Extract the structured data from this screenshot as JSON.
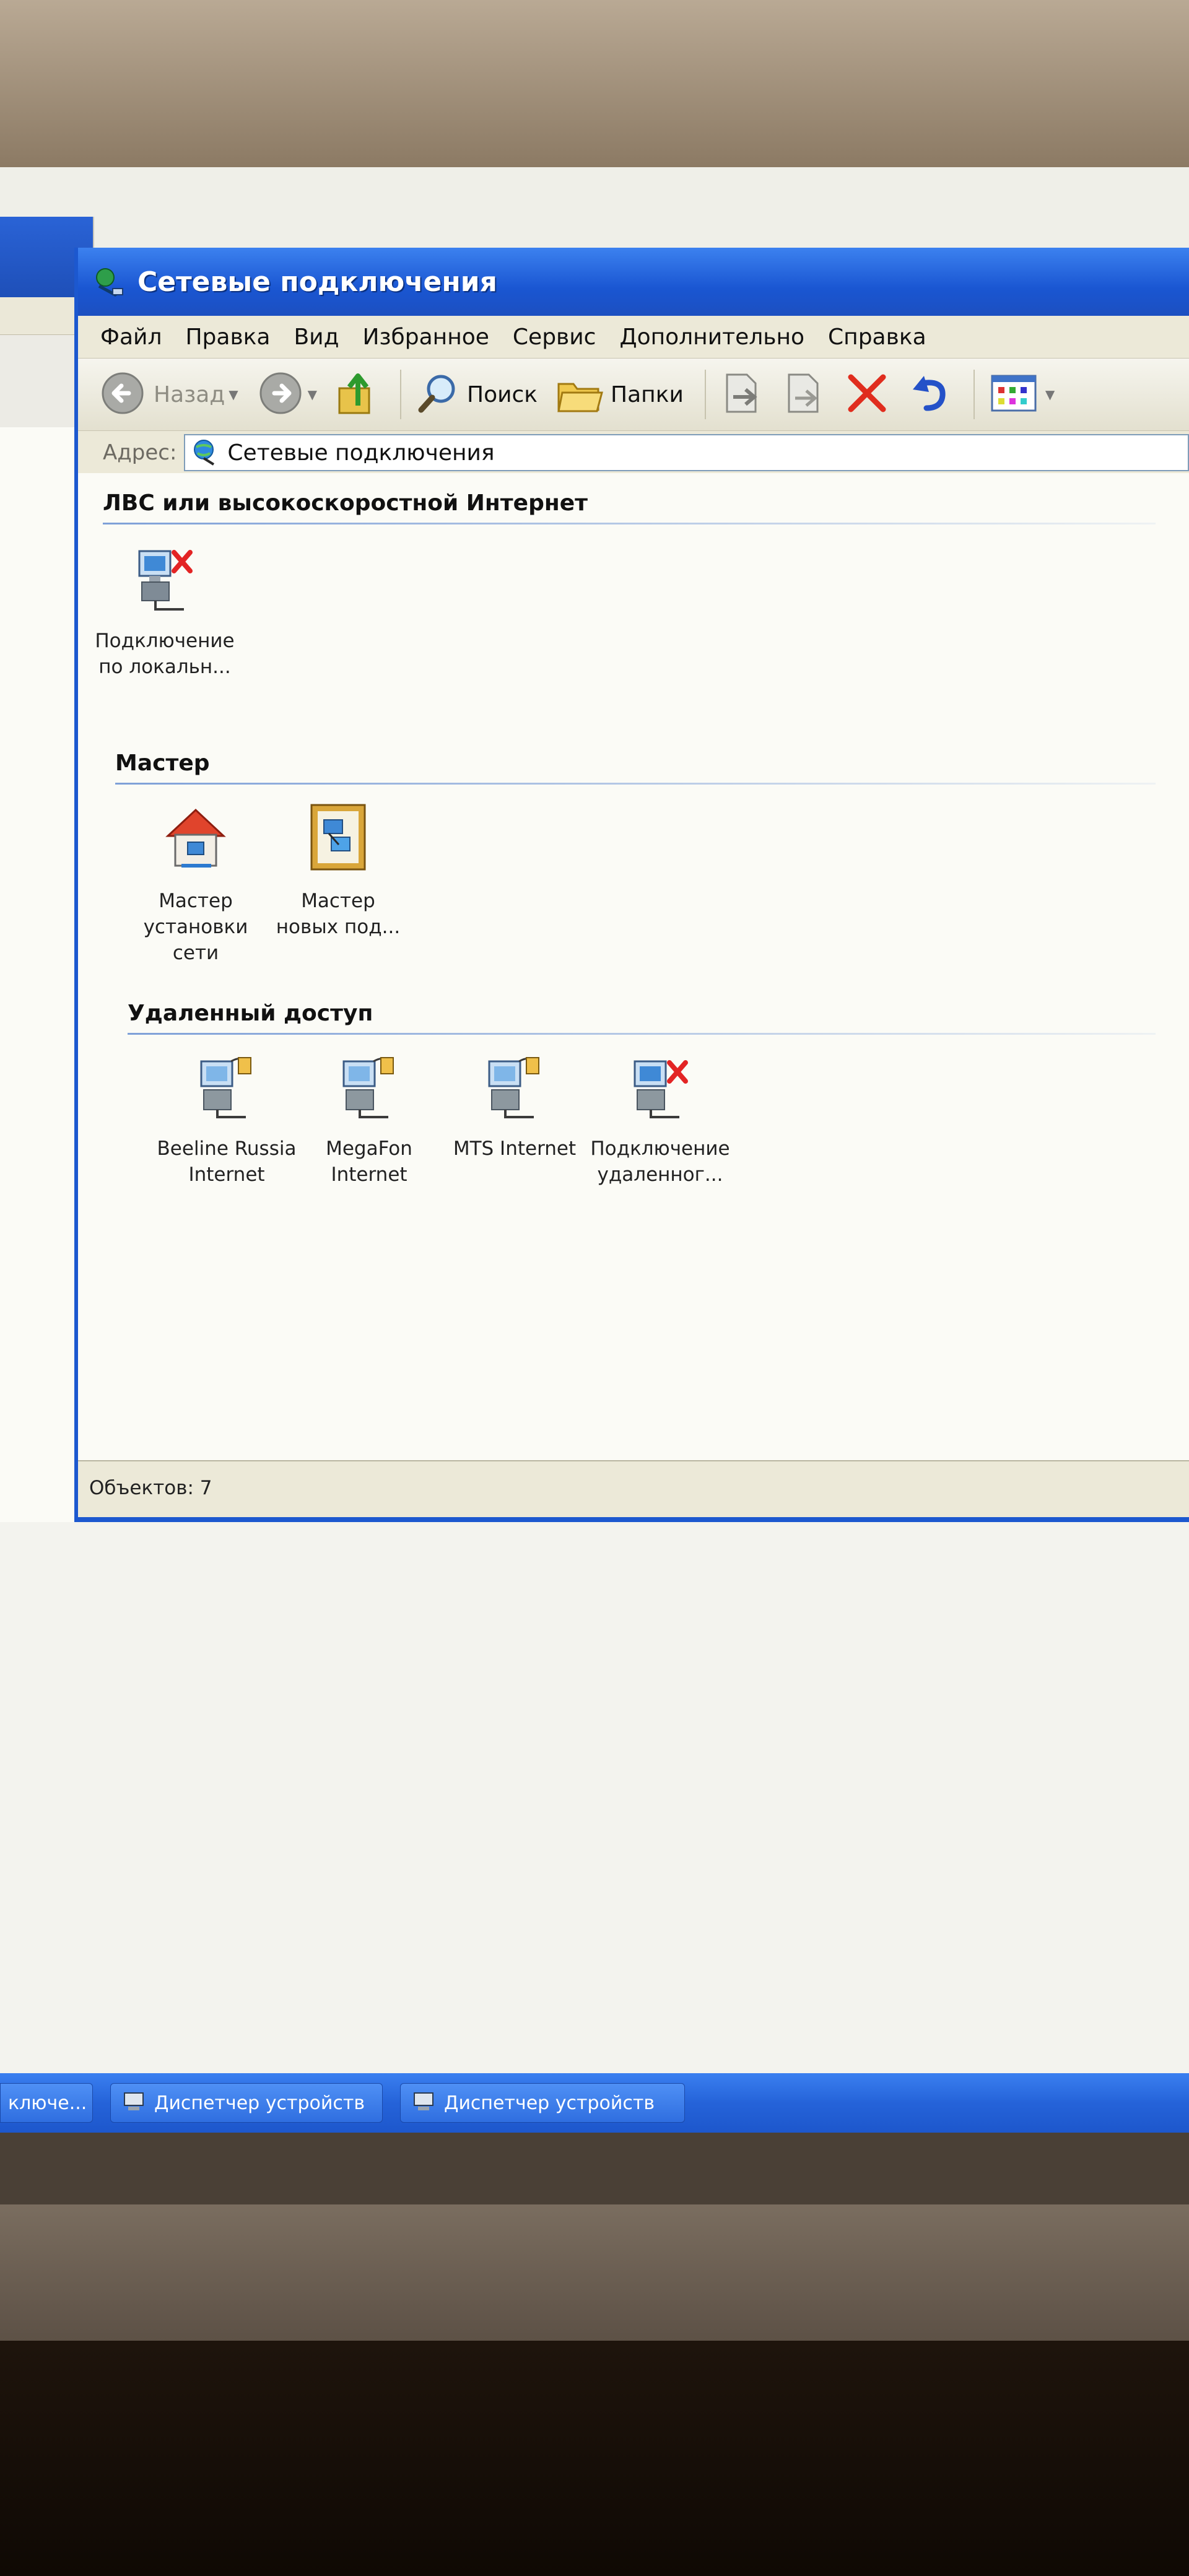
{
  "window": {
    "title": "Сетевые подключения"
  },
  "menu": [
    "Файл",
    "Правка",
    "Вид",
    "Избранное",
    "Сервис",
    "Дополнительно",
    "Справка"
  ],
  "toolbar": {
    "back_label": "Назад",
    "search_label": "Поиск",
    "folders_label": "Папки"
  },
  "address": {
    "label": "Адрес:",
    "value": "Сетевые подключения"
  },
  "groups": {
    "lan": {
      "title": "ЛВС или высокоскоростной Интернет",
      "items": [
        {
          "label_line1": "Подключение",
          "label_line2": "по локальн..."
        }
      ]
    },
    "wizard": {
      "title": "Мастер",
      "items": [
        {
          "label_line1": "Мастер",
          "label_line2": "установки",
          "label_line3": "сети"
        },
        {
          "label_line1": "Мастер",
          "label_line2": "новых под..."
        }
      ]
    },
    "dialup": {
      "title": "Удаленный доступ",
      "items": [
        {
          "label_line1": "Beeline Russia",
          "label_line2": "Internet"
        },
        {
          "label_line1": "MegaFon",
          "label_line2": "Internet"
        },
        {
          "label_line1": "MTS Internet"
        },
        {
          "label_line1": "Подключение",
          "label_line2": "удаленног..."
        }
      ]
    }
  },
  "status": {
    "text": "Объектов: 7"
  },
  "taskbar": {
    "items": [
      "ключе...",
      "Диспетчер устройств",
      "Диспетчер устройств"
    ]
  },
  "colors": {
    "titlebar": "#1a56d2",
    "taskbar": "#2563d9",
    "window_bg": "#ece9d8",
    "content_bg": "#fbfbf6"
  }
}
